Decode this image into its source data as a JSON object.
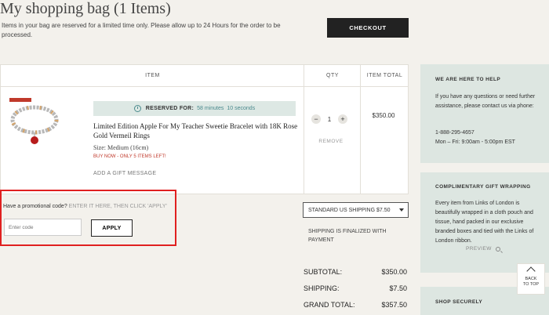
{
  "header": {
    "title": "My shopping bag (1 Items)",
    "reserve_note": "Items in your bag are reserved for a limited time only. Please allow up to 24 Hours for the order to be processed.",
    "checkout_label": "CHECKOUT"
  },
  "table": {
    "col_item": "ITEM",
    "col_qty": "QTY",
    "col_total": "ITEM TOTAL"
  },
  "item": {
    "reserved_label": "RESERVED FOR:",
    "reserved_minutes": "58 minutes",
    "reserved_seconds": "10 seconds",
    "name": "Limited Edition Apple For My Teacher Sweetie Bracelet with 18K Rose Gold Vermeil Rings",
    "size": "Size: Medium (16cm)",
    "stock_note": "BUY NOW - ONLY 5 ITEMS LEFT!",
    "gift_message": "ADD A GIFT MESSAGE",
    "quantity": "1",
    "remove_label": "REMOVE",
    "total": "$350.00"
  },
  "promo": {
    "question": "Have a promotional code?",
    "hint": "ENTER IT HERE, THEN CLICK 'APPLY'",
    "placeholder": "Enter code",
    "apply_label": "APPLY"
  },
  "shipping": {
    "selected": "STANDARD US SHIPPING $7.50",
    "note": "SHIPPING IS FINALIZED WITH PAYMENT"
  },
  "summary": {
    "subtotal_label": "SUBTOTAL:",
    "subtotal": "$350.00",
    "shipping_label": "SHIPPING:",
    "shipping": "$7.50",
    "grand_label": "GRAND TOTAL:",
    "grand": "$357.50"
  },
  "help": {
    "title": "WE ARE HERE TO HELP",
    "text": "If you have any questions or need further assistance, please contact us via phone:",
    "phone": "1-888-295-4657",
    "hours": "Mon – Fri: 9:00am - 5:00pm EST"
  },
  "gift": {
    "title": "COMPLIMENTARY GIFT WRAPPING",
    "text": "Every item from Links of London is beautifully wrapped in a cloth pouch and tissue, hand packed in our exclusive branded boxes and tied with the Links of London ribbon.",
    "preview_label": "PREVIEW"
  },
  "secure": {
    "title": "SHOP SECURELY"
  },
  "back_to_top": {
    "line1": "BACK",
    "line2": "TO TOP"
  },
  "colors": {
    "accent": "#4b8a8d",
    "side_panel": "#dde6e1",
    "highlight": "#e02020"
  }
}
